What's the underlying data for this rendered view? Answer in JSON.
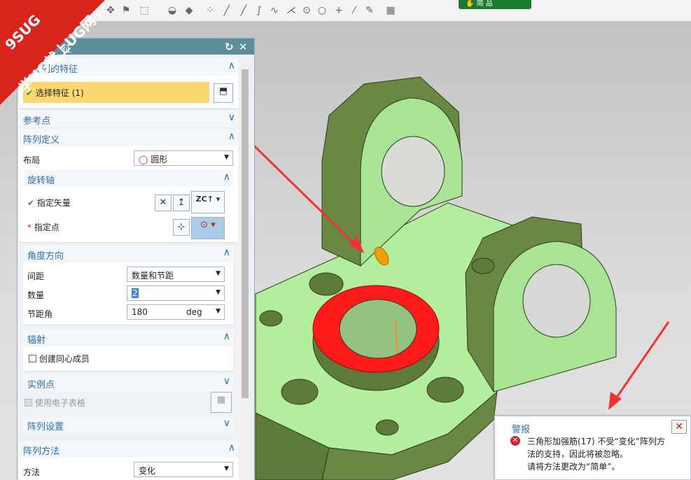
{
  "toolbar": {
    "selection_label": "简 品"
  },
  "watermark": {
    "line1": "9SUG",
    "line2": "学UG就上UG网"
  },
  "dialog": {
    "title": "征",
    "sections": {
      "features": {
        "header": "成阵列的特征",
        "select_label": "选择特征 (1)"
      },
      "ref_point": {
        "header": "参考点"
      },
      "pattern_def": {
        "header": "阵列定义",
        "layout_label": "布局",
        "layout_value": "圆形"
      },
      "rotation_axis": {
        "header": "旋转轴",
        "vector_label": "指定矢量",
        "point_label": "指定点",
        "zc_label": "ZC"
      },
      "angle_dir": {
        "header": "角度方向",
        "spacing_label": "间距",
        "spacing_value": "数量和节距",
        "count_label": "数量",
        "count_value": "2",
        "pitch_label": "节距角",
        "pitch_value": "180",
        "pitch_unit": "deg"
      },
      "radiation": {
        "header": "辐射",
        "concentric_label": "创建同心成员"
      },
      "instance_points": {
        "header": "实例点",
        "spreadsheet_label": "使用电子表格"
      },
      "pattern_settings": {
        "header": "阵列设置"
      },
      "pattern_method": {
        "header": "阵列方法",
        "method_label": "方法",
        "method_value": "变化"
      }
    }
  },
  "alert": {
    "title": "警报",
    "message_line1": "三角形加强筋(17) 不受“变化”阵列方",
    "message_line2": "法的支持，因此将被忽略。",
    "message_line3": "请将方法更改为“简单”。"
  },
  "colors": {
    "model_green": "#aee89a",
    "model_dark": "#5f7b3b",
    "highlight_red": "#ff1a1a",
    "title_bar": "#5e8e9b",
    "arrow_red": "#ee3333"
  }
}
